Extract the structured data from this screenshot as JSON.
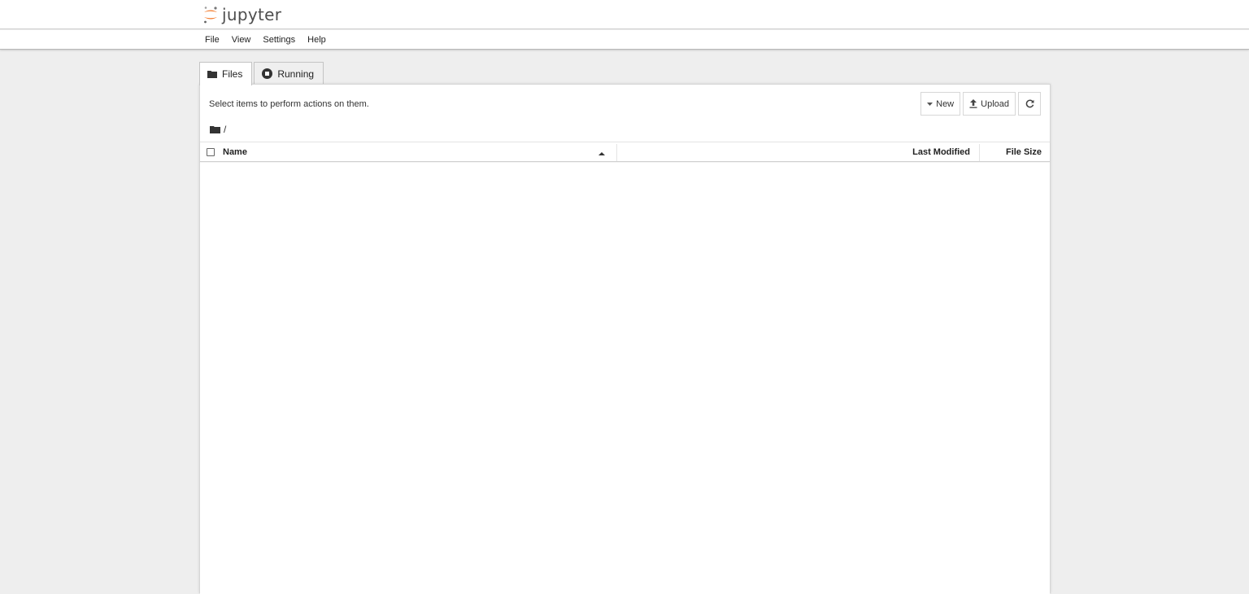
{
  "header": {
    "logo_text": "jupyter",
    "colors": {
      "logo_orange": "#F37726",
      "logo_text": "#4E4E4E"
    }
  },
  "menu": {
    "items": [
      {
        "label": "File"
      },
      {
        "label": "View"
      },
      {
        "label": "Settings"
      },
      {
        "label": "Help"
      }
    ]
  },
  "tabs": [
    {
      "label": "Files",
      "icon": "folder-icon",
      "active": true
    },
    {
      "label": "Running",
      "icon": "stop-circle-icon",
      "active": false
    }
  ],
  "panel": {
    "hint": "Select items to perform actions on them.",
    "toolbar": {
      "new_label": "New",
      "upload_label": "Upload",
      "refresh_icon": "refresh-icon"
    },
    "breadcrumb": {
      "path": "/"
    },
    "columns": {
      "name": "Name",
      "last_modified": "Last Modified",
      "file_size": "File Size",
      "sort": "ascending"
    },
    "items": []
  }
}
